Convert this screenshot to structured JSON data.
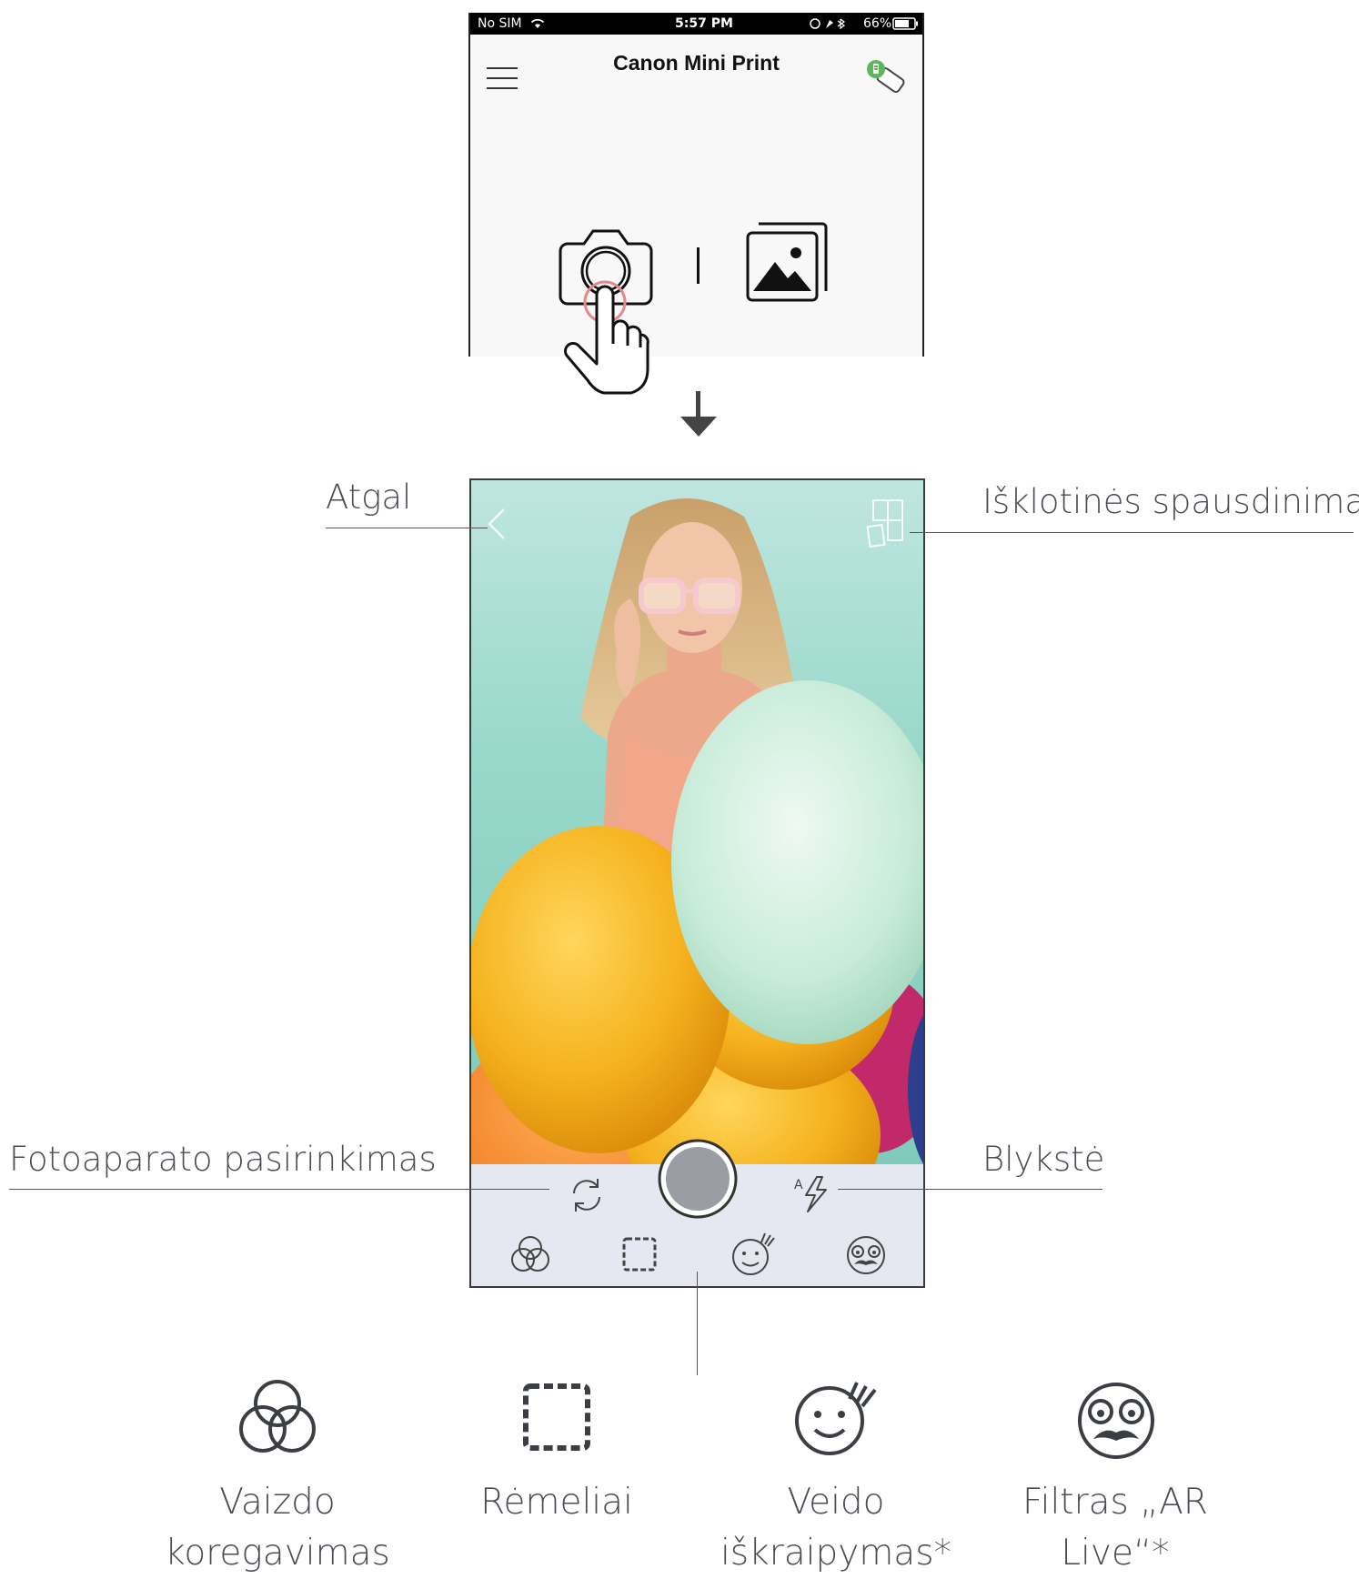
{
  "status_bar": {
    "carrier": "No SIM",
    "time": "5:57 PM",
    "battery": "66%"
  },
  "app": {
    "title": "Canon Mini Print"
  },
  "callouts": {
    "back": "Atgal",
    "tile_print": "Išklotinės spausdinimas",
    "camera_switch": "Fotoaparato pasirinkimas",
    "flash": "Blykstė"
  },
  "features": [
    {
      "icon": "adjust-icon",
      "label_line1": "Vaizdo",
      "label_line2": "koregavimas"
    },
    {
      "icon": "frame-icon",
      "label_line1": "Rėmeliai",
      "label_line2": ""
    },
    {
      "icon": "face-warp-icon",
      "label_line1": "Veido",
      "label_line2": "iškraipymas*"
    },
    {
      "icon": "ar-live-icon",
      "label_line1": "Filtras „AR",
      "label_line2": "Live“*"
    }
  ],
  "colors": {
    "toolbar_bg": "#e5e8f0",
    "photo_bg": "#98d8ca",
    "battery_badge": "#5cb85c"
  }
}
